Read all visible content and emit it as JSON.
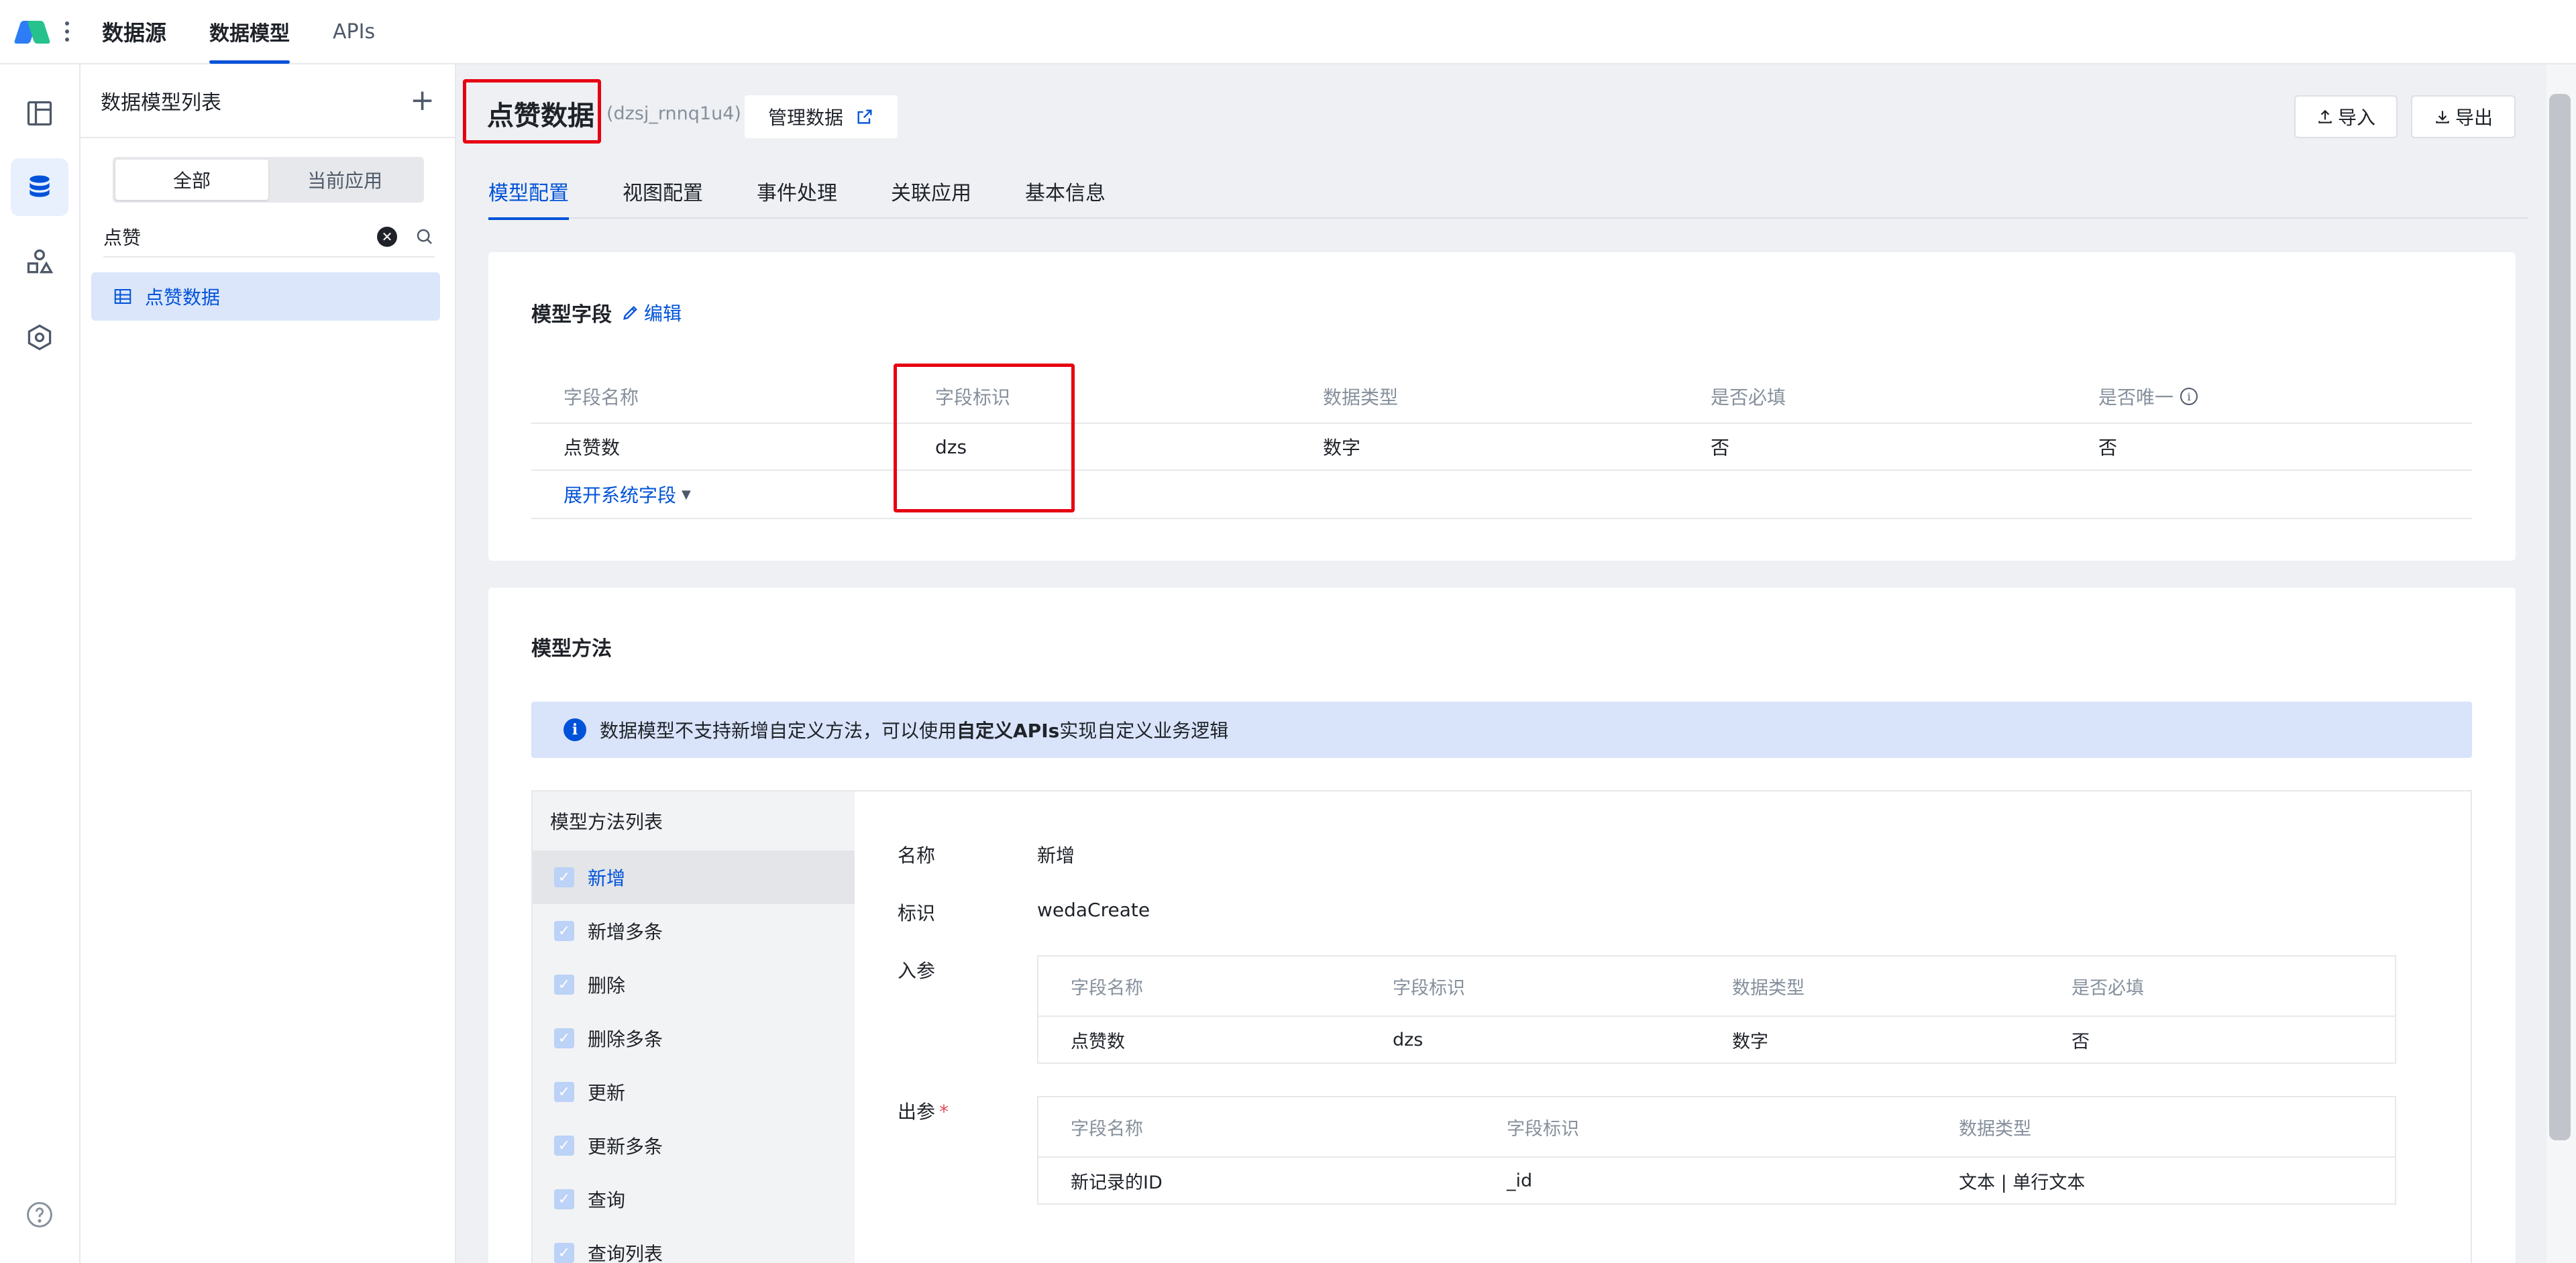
{
  "topbar": {
    "brand": "数据源",
    "tabs": [
      {
        "label": "数据模型",
        "active": true
      },
      {
        "label": "APIs",
        "active": false
      }
    ]
  },
  "rail": {
    "items": [
      {
        "icon": "layout-icon"
      },
      {
        "icon": "database-icon",
        "active": true
      },
      {
        "icon": "shapes-icon"
      },
      {
        "icon": "hexagon-settings-icon"
      }
    ],
    "help_icon": "help-circle-icon"
  },
  "list_panel": {
    "title": "数据模型列表",
    "add_label": "+",
    "segments": [
      "全部",
      "当前应用"
    ],
    "search_value": "点赞",
    "items": [
      {
        "label": "点赞数据"
      }
    ]
  },
  "header": {
    "title": "点赞数据",
    "id_text": "(dzsj_rnnq1u4)",
    "manage_label": "管理数据",
    "import_label": "导入",
    "export_label": "导出"
  },
  "tabs": [
    "模型配置",
    "视图配置",
    "事件处理",
    "关联应用",
    "基本信息"
  ],
  "fields_section": {
    "title": "模型字段",
    "edit_label": "编辑",
    "columns": [
      "字段名称",
      "字段标识",
      "数据类型",
      "是否必填",
      "是否唯一"
    ],
    "rows": [
      [
        "点赞数",
        "dzs",
        "数字",
        "否",
        "否"
      ]
    ],
    "expand_label": "展开系统字段"
  },
  "methods_section": {
    "title": "模型方法",
    "notice_pre": "数据模型不支持新增自定义方法，可以使用",
    "notice_bold": "自定义APIs",
    "notice_post": "实现自定义业务逻辑",
    "list_title": "模型方法列表",
    "methods": [
      "新增",
      "新增多条",
      "删除",
      "删除多条",
      "更新",
      "更新多条",
      "查询",
      "查询列表"
    ],
    "detail": {
      "name_key": "名称",
      "name_value": "新增",
      "id_key": "标识",
      "id_value": "wedaCreate",
      "input_key": "入参",
      "input_columns": [
        "字段名称",
        "字段标识",
        "数据类型",
        "是否必填"
      ],
      "input_rows": [
        [
          "点赞数",
          "dzs",
          "数字",
          "否"
        ]
      ],
      "output_key": "出参",
      "output_required": "*",
      "output_columns": [
        "字段名称",
        "字段标识",
        "数据类型"
      ],
      "output_rows": [
        [
          "新记录的ID",
          "_id",
          "文本 | 单行文本"
        ]
      ]
    }
  }
}
